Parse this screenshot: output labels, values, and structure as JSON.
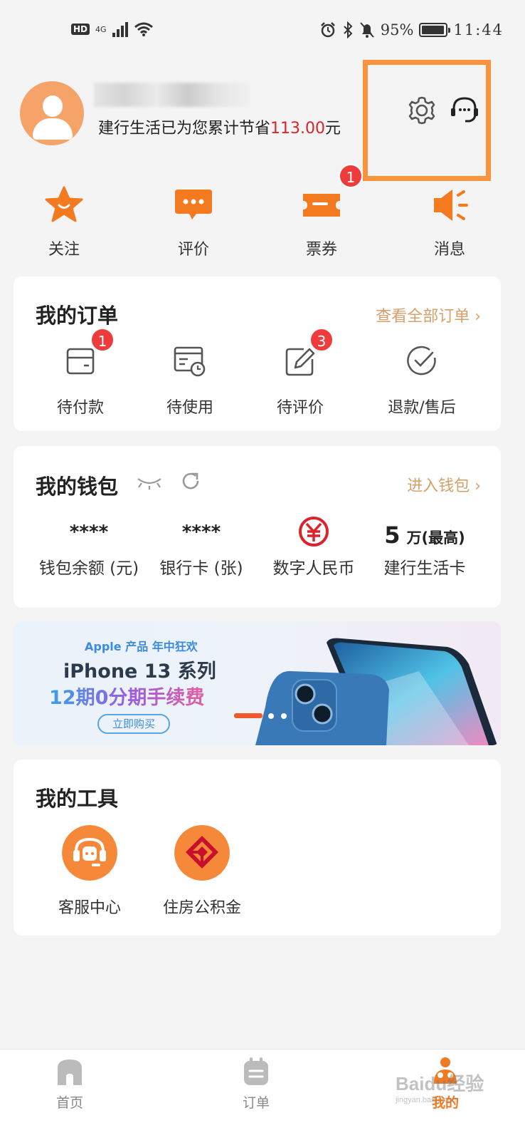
{
  "status_bar": {
    "hd": "HD",
    "network": "4G",
    "battery_pct": "95%",
    "battery_level": 0.95,
    "time": "11:44"
  },
  "profile": {
    "savings_prefix": "建行生活已为您累计节省",
    "savings_amount": "113.00",
    "savings_suffix": "元"
  },
  "quick_actions": [
    {
      "label": "关注",
      "icon": "star-icon"
    },
    {
      "label": "评价",
      "icon": "chat-icon"
    },
    {
      "label": "票券",
      "icon": "ticket-icon",
      "badge": "1"
    },
    {
      "label": "消息",
      "icon": "speaker-icon"
    }
  ],
  "orders": {
    "title": "我的订单",
    "link": "查看全部订单 ›",
    "items": [
      {
        "label": "待付款",
        "icon": "wallet-card-icon",
        "badge": "1"
      },
      {
        "label": "待使用",
        "icon": "card-clock-icon"
      },
      {
        "label": "待评价",
        "icon": "edit-icon",
        "badge": "3"
      },
      {
        "label": "退款/售后",
        "icon": "check-circle-icon"
      }
    ]
  },
  "wallet": {
    "title": "我的钱包",
    "link": "进入钱包 ›",
    "items": [
      {
        "value": "****",
        "label": "钱包余额 (元)"
      },
      {
        "value": "****",
        "label": "银行卡 (张)"
      },
      {
        "value": "",
        "label": "数字人民币",
        "icon": "digital-rmb-icon"
      },
      {
        "value_num": "5",
        "value_unit": "万(最高)",
        "label": "建行生活卡"
      }
    ]
  },
  "banner": {
    "top": "Apple 产品 年中狂欢",
    "title": "iPhone 13 系列",
    "subtitle": "12期0分期手续费",
    "button": "立即购买"
  },
  "tools": {
    "title": "我的工具",
    "items": [
      {
        "label": "客服中心",
        "icon": "headset-icon"
      },
      {
        "label": "住房公积金",
        "icon": "housing-fund-icon"
      }
    ]
  },
  "bottom_nav": [
    {
      "label": "首页",
      "icon": "home-icon"
    },
    {
      "label": "订单",
      "icon": "order-icon"
    },
    {
      "label": "我的",
      "icon": "profile-icon",
      "active": true
    }
  ],
  "watermark": {
    "main": "Baidu经验",
    "sub": "jingyan.baidu.com"
  },
  "colors": {
    "accent": "#f07b22",
    "highlight": "#fb923c",
    "badge": "#ee3c3c",
    "link": "#d6a06a",
    "price": "#d9232d"
  }
}
